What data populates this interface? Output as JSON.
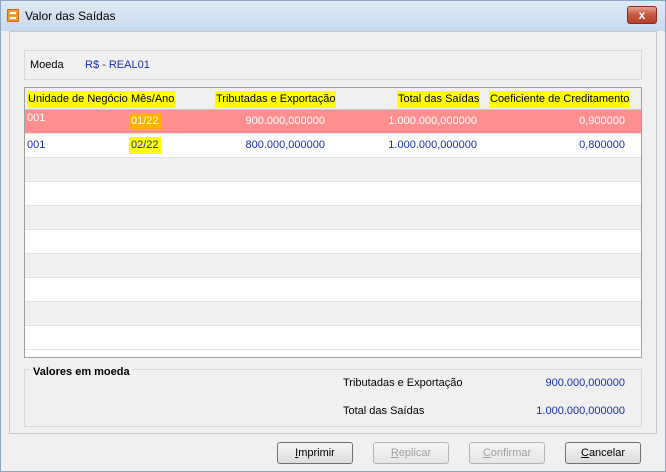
{
  "window": {
    "title": "Valor das Saídas",
    "close_label": "x"
  },
  "moeda": {
    "label": "Moeda",
    "value": "R$ - REAL01"
  },
  "table": {
    "headers": {
      "unidade": "Unidade de Negócio",
      "mes": "Mês/Ano",
      "tributadas": "Tributadas e Exportação",
      "total": "Total das Saídas",
      "coeficiente": "Coeficiente de Creditamento"
    },
    "rows": [
      {
        "unidade": "001",
        "mes": "01/22",
        "tributadas": "900.000,000000",
        "total": "1.000.000,000000",
        "coeficiente": "0,900000"
      },
      {
        "unidade": "001",
        "mes": "02/22",
        "tributadas": "800.000,000000",
        "total": "1.000.000,000000",
        "coeficiente": "0,800000"
      }
    ]
  },
  "valores": {
    "title": "Valores em moeda",
    "tributadas_label": "Tributadas e Exportação",
    "tributadas_value": "900.000,000000",
    "total_label": "Total das Saídas",
    "total_value": "1.000.000,000000"
  },
  "buttons": {
    "imprimir_first": "I",
    "imprimir_rest": "mprimir",
    "replicar_first": "R",
    "replicar_rest": "eplicar",
    "confirmar_first": "C",
    "confirmar_rest": "onfirmar",
    "cancelar_first": "C",
    "cancelar_rest": "ancelar"
  }
}
